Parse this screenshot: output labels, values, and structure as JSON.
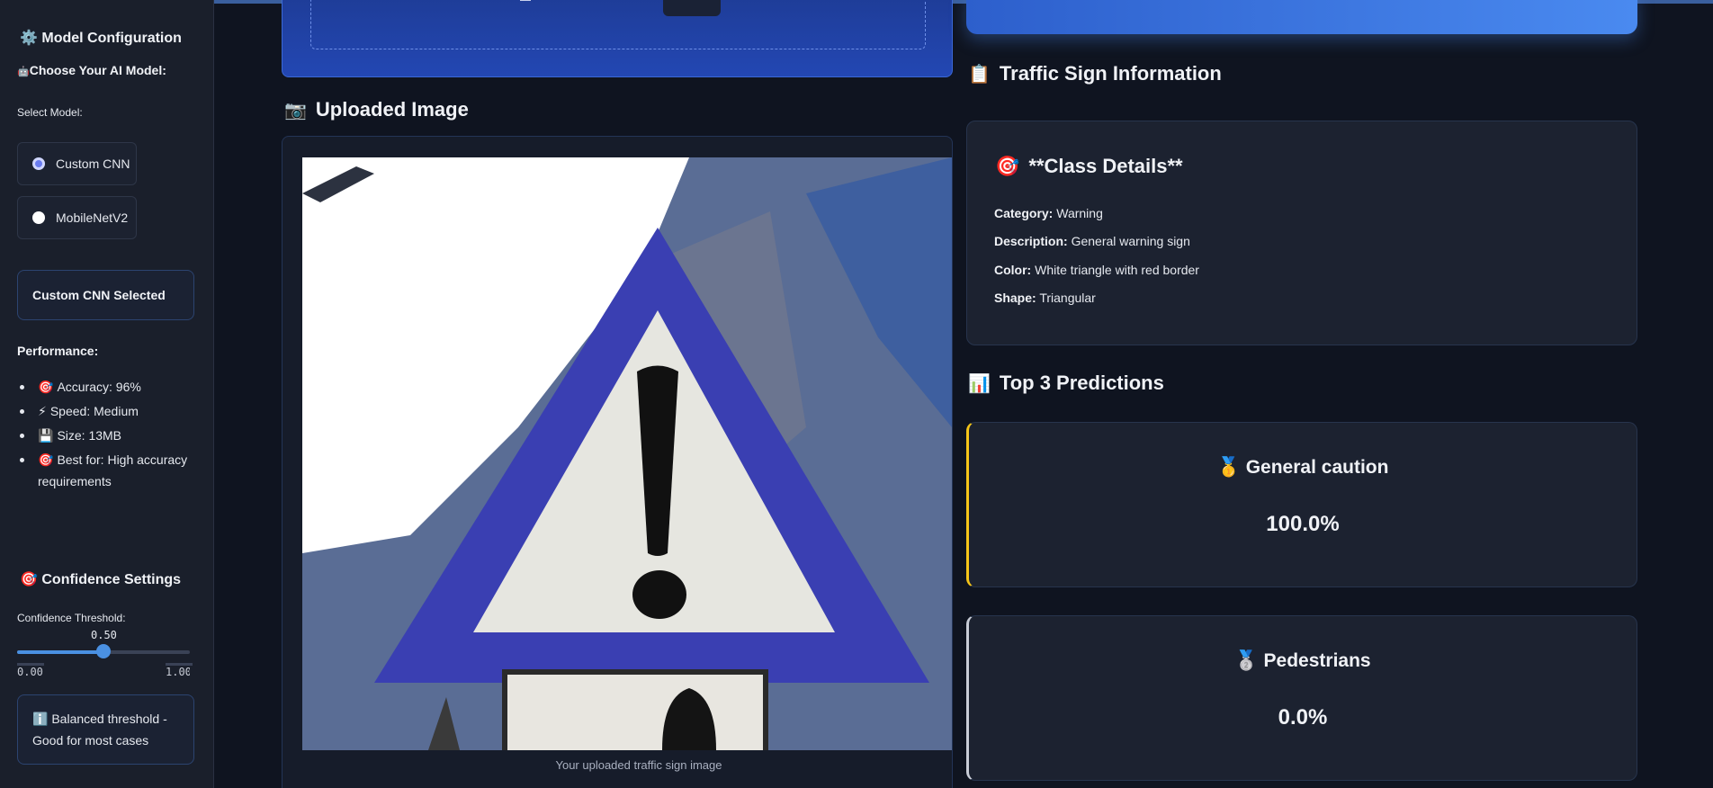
{
  "sidebar": {
    "title": "Model Configuration",
    "title_icon": "gear-icon",
    "subtitle": "Choose Your AI Model:",
    "subtitle_icon": "robot-icon",
    "select_label": "Select Model:",
    "options": [
      {
        "label": "Custom CNN",
        "selected": true
      },
      {
        "label": "MobileNetV2",
        "selected": false
      }
    ],
    "selected_banner": "Custom CNN Selected",
    "performance_title": "Performance:",
    "performance": [
      {
        "icon": "target-icon",
        "text": "Accuracy: 96%"
      },
      {
        "icon": "lightning-icon",
        "text": "Speed: Medium"
      },
      {
        "icon": "floppy-disk-icon",
        "text": "Size: 13MB"
      },
      {
        "icon": "target-icon",
        "text": "Best for: High accuracy requirements"
      }
    ],
    "confidence_title": "Confidence Settings",
    "confidence_icon": "target-icon",
    "threshold_label": "Confidence Threshold:",
    "threshold_value": "0.50",
    "threshold_fraction": 0.5,
    "threshold_min": "0.00",
    "threshold_max": "1.00",
    "info_icon": "info-icon",
    "info_text": "Balanced threshold - Good for most cases"
  },
  "main": {
    "uploaded_title": "Uploaded Image",
    "uploaded_icon": "camera-icon",
    "image_caption": "Your uploaded traffic sign image",
    "info_title": "Traffic Sign Information",
    "info_icon": "clipboard-icon",
    "class_details_title": "**Class Details**",
    "class_details_icon": "target-icon",
    "details": [
      {
        "label": "Category:",
        "value": "Warning"
      },
      {
        "label": "Description:",
        "value": "General warning sign"
      },
      {
        "label": "Color:",
        "value": "White triangle with red border"
      },
      {
        "label": "Shape:",
        "value": "Triangular"
      }
    ],
    "predictions_title": "Top 3 Predictions",
    "predictions_icon": "bar-chart-icon",
    "predictions": [
      {
        "medal": "gold-medal-icon",
        "name": "General caution",
        "confidence": "100.0%"
      },
      {
        "medal": "silver-medal-icon",
        "name": "Pedestrians",
        "confidence": "0.0%"
      }
    ]
  },
  "colors": {
    "accent": "#4a90e2",
    "gold": "#f5c518",
    "silver": "#c8ccd6",
    "upload_bg": "#2347b3"
  }
}
